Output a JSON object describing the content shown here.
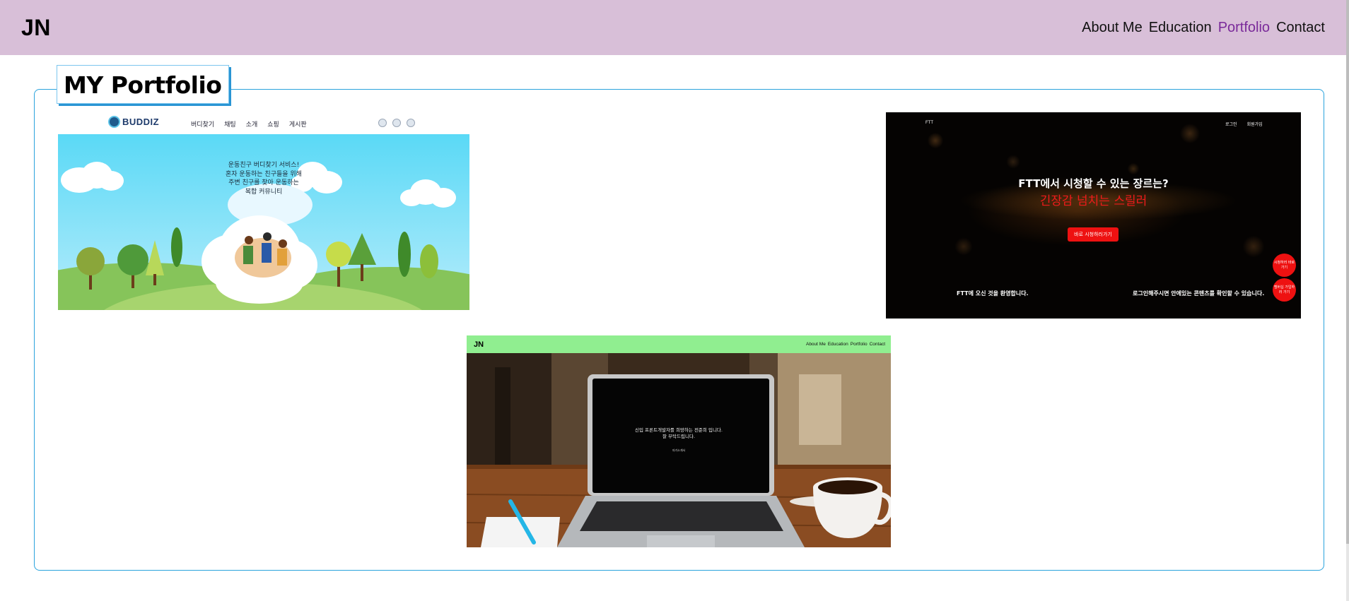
{
  "header": {
    "logo": "JN",
    "nav": [
      {
        "label": "About Me",
        "active": false
      },
      {
        "label": "Education",
        "active": false
      },
      {
        "label": "Portfolio",
        "active": true
      },
      {
        "label": "Contact",
        "active": false
      }
    ]
  },
  "portfolio": {
    "title": "MY Portfolio",
    "items": [
      {
        "brand": "BUDDIZ",
        "menu": [
          "버디찾기",
          "채팅",
          "소개",
          "쇼핑",
          "게시판"
        ],
        "icons": [
          "cart-icon",
          "mail-icon",
          "user-icon"
        ],
        "copy": [
          "운동친구 버디찾기 서비스!",
          "혼자 운동하는 친구들을 위해",
          "주변 친구를 찾아 운동하는",
          "복합 커뮤니티"
        ]
      },
      {
        "brand": "FTT",
        "nav_right": [
          "로그인",
          "회원가입"
        ],
        "headline": "FTT에서 시청할 수 있는 장르는?",
        "subline": "긴장감 넘치는 스릴러",
        "cta": "바로 시청하러가기",
        "footer_left": "FTT에 오신 것을 환영합니다.",
        "footer_right": "로그인해주시면 안에있는 콘텐츠를 확인할 수 있습니다.",
        "float_1": "시청하러 바로가기",
        "float_2": "멤버십 가입하러 가기"
      },
      {
        "logo": "JN",
        "nav": [
          "About Me",
          "Education",
          "Portfolio",
          "Contact"
        ],
        "screen_lines": [
          "신입 프론트개발자를 희망하는 전준희 입니다.",
          "잘 부탁드립니다."
        ],
        "screen_button": "자기소개서"
      }
    ]
  },
  "colors": {
    "header_bg": "#d8bfd8",
    "nav_active": "#7a2a9a",
    "section_border": "#2aa3dd",
    "thumb3_bar": "#90ee90",
    "ftt_red": "#ee1111"
  }
}
